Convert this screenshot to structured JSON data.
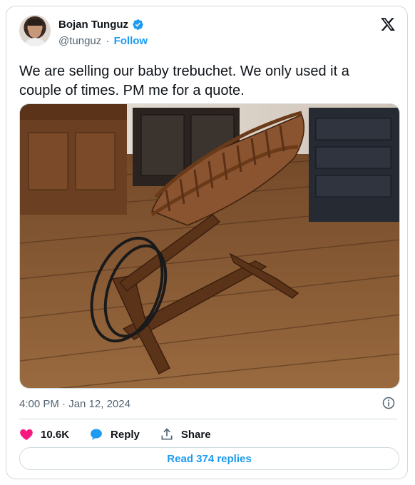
{
  "author": {
    "name": "Bojan Tunguz",
    "handle": "@tunguz",
    "separator": "·",
    "follow_label": "Follow",
    "verified_icon": "verified-badge-icon"
  },
  "platform_logo": "x-logo-icon",
  "tweet": {
    "text": "We are selling our baby trebuchet. We only used it a couple of times. PM me for a quote."
  },
  "media": {
    "description_icon": "cradle-photo"
  },
  "meta": {
    "timestamp": "4:00 PM · Jan 12, 2024",
    "info_icon": "info-icon"
  },
  "actions": {
    "like_count": "10.6K",
    "like_icon": "heart-icon",
    "reply_label": "Reply",
    "reply_icon": "reply-bubble-icon",
    "share_label": "Share",
    "share_icon": "share-icon"
  },
  "read_replies_label": "Read 374 replies",
  "colors": {
    "accent": "#1d9bf0",
    "like": "#f91880",
    "text": "#0f1419",
    "muted": "#536471",
    "border": "#cfd9de"
  }
}
